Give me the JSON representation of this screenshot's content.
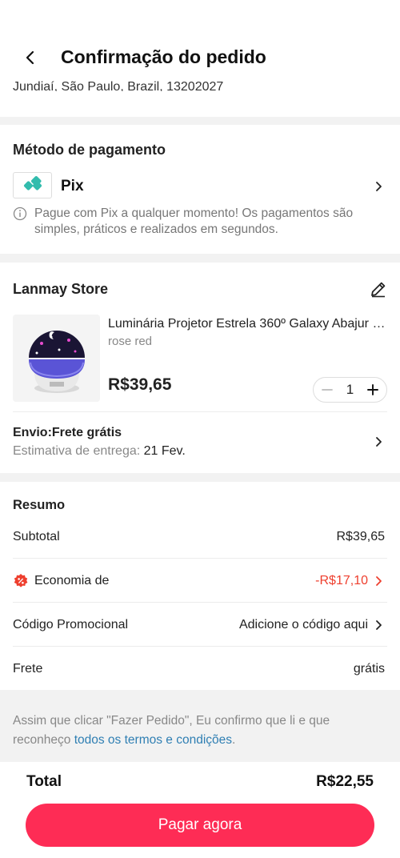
{
  "header": {
    "title": "Confirmação do pedido",
    "address": "Jundiaí, São Paulo, Brazil, 13202027"
  },
  "payment": {
    "section_title": "Método de pagamento",
    "method_label": "Pix",
    "note": "Pague com Pix a qualquer momento! Os pagamentos são simples, práticos e realizados em segundos.",
    "pix_color": "#32bcad"
  },
  "store": {
    "name": "Lanmay Store",
    "product": {
      "name": "Luminária Projetor Estrela 360º Galaxy Abajur Quarto",
      "variant": "rose red",
      "price": "R$39,65",
      "quantity": "1"
    },
    "shipping": {
      "title": "Envio:Frete grátis",
      "estimate_label": "Estimativa de entrega: ",
      "estimate_date": "21 Fev."
    }
  },
  "summary": {
    "title": "Resumo",
    "rows": [
      {
        "label": "Subtotal",
        "value": "R$39,65"
      },
      {
        "label": "Economia de",
        "value": "-R$17,10"
      },
      {
        "label": "Código Promocional",
        "value": "Adicione o código aqui"
      },
      {
        "label": "Frete",
        "value": "grátis"
      }
    ]
  },
  "terms": {
    "text": "Assim que clicar \"Fazer Pedido\", Eu confirmo que li e que reconheço ",
    "link": "todos os termos e condições",
    "end": "."
  },
  "footer": {
    "total_label": "Total",
    "total_value": "R$22,55",
    "pay_label": "Pagar agora",
    "accent_color": "#fe2c55"
  }
}
